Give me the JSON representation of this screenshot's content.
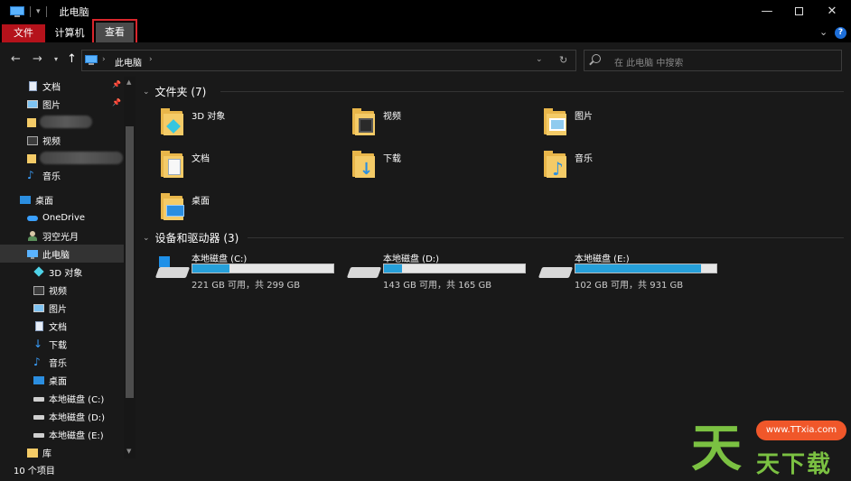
{
  "window": {
    "title": "此电脑"
  },
  "ribbon": {
    "tabs": [
      "文件",
      "计算机",
      "查看"
    ]
  },
  "address": {
    "crumb": "此电脑",
    "search_placeholder": "在 此电脑 中搜索"
  },
  "sidebar": {
    "quick": [
      {
        "label": "文档",
        "pinned": true
      },
      {
        "label": "图片",
        "pinned": true
      },
      {
        "label": "视频"
      },
      {
        "label": "音乐"
      }
    ],
    "desktop": "桌面",
    "onedrive": "OneDrive",
    "user": "羽空光月",
    "thispc": "此电脑",
    "pc_children": [
      "3D 对象",
      "视频",
      "图片",
      "文档",
      "下载",
      "音乐",
      "桌面",
      "本地磁盘 (C:)",
      "本地磁盘 (D:)",
      "本地磁盘 (E:)"
    ],
    "library": "库"
  },
  "folders": {
    "header": "文件夹 (7)",
    "items": [
      "3D 对象",
      "视频",
      "图片",
      "文档",
      "下载",
      "音乐",
      "桌面"
    ]
  },
  "drives": {
    "header": "设备和驱动器 (3)",
    "items": [
      {
        "label": "本地磁盘 (C:)",
        "info": "221 GB 可用，共 299 GB",
        "used_fraction": 0.26
      },
      {
        "label": "本地磁盘 (D:)",
        "info": "143 GB 可用，共 165 GB",
        "used_fraction": 0.13
      },
      {
        "label": "本地磁盘 (E:)",
        "info": "102 GB 可用，共 931 GB",
        "used_fraction": 0.89
      }
    ]
  },
  "status": {
    "count": "10 个项目"
  },
  "watermark": {
    "text": "天天下载",
    "site": "www.TTxia.com"
  },
  "colors": {
    "accent": "#26a0da",
    "file_tab": "#b5121b",
    "highlight_box": "#d9262c"
  }
}
